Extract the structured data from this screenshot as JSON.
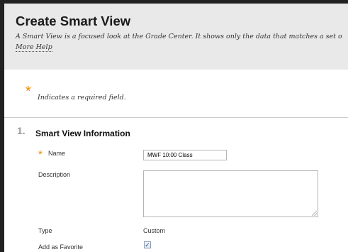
{
  "header": {
    "title": "Create Smart View",
    "description": "A Smart View is a focused look at the Grade Center. It shows only the data that matches a set o",
    "more_help": "More Help"
  },
  "required_note": {
    "star": "*",
    "text": "Indicates a required field."
  },
  "section": {
    "number": "1.",
    "title": "Smart View Information"
  },
  "fields": {
    "name": {
      "star": "*",
      "label": "Name",
      "value": "MWF 10:00 Class"
    },
    "description": {
      "label": "Description",
      "value": ""
    },
    "type": {
      "label": "Type",
      "value": "Custom"
    },
    "favorite": {
      "label": "Add as Favorite",
      "checked": true,
      "check_glyph": "✓"
    }
  },
  "colors": {
    "header_bg": "#e9e9e9",
    "required_star": "#f08a00",
    "step_number": "#999999",
    "frame": "#222222"
  }
}
